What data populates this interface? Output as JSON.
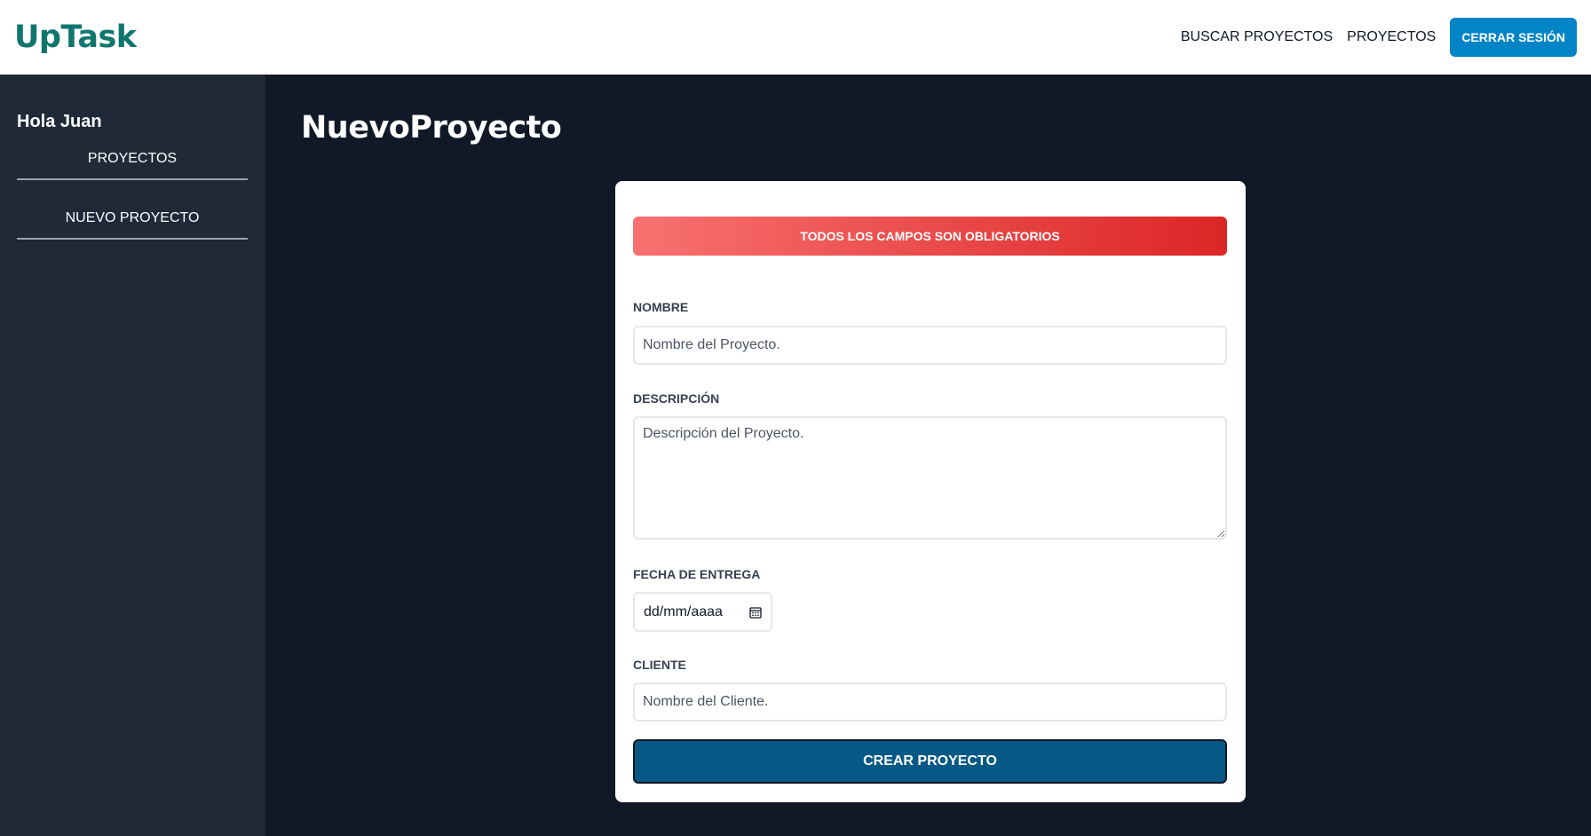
{
  "header": {
    "logo": "UpTask",
    "nav": {
      "search_label": "BUSCAR PROYECTOS",
      "projects_label": "PROYECTOS",
      "logout_label": "CERRAR SESIÓN"
    }
  },
  "sidebar": {
    "greeting": "Hola Juan",
    "items": [
      {
        "label": "PROYECTOS"
      },
      {
        "label": "NUEVO PROYECTO"
      }
    ]
  },
  "main": {
    "title": "NuevoProyecto",
    "form": {
      "alert": "TODOS LOS CAMPOS SON OBLIGATORIOS",
      "nombre": {
        "label": "NOMBRE",
        "placeholder": "Nombre del Proyecto.",
        "value": ""
      },
      "descripcion": {
        "label": "DESCRIPCIÓN",
        "placeholder": "Descripción del Proyecto.",
        "value": ""
      },
      "fecha": {
        "label": "FECHA DE ENTREGA",
        "placeholder": "dd/mm/aaaa",
        "icon": "calendar-icon"
      },
      "cliente": {
        "label": "CLIENTE",
        "placeholder": "Nombre del Cliente.",
        "value": ""
      },
      "submit_label": "CREAR PROYECTO"
    }
  },
  "colors": {
    "brand": "#0f766e",
    "header_bg": "#ffffff",
    "sidebar_bg": "#1f2937",
    "main_bg": "#111827",
    "logout_button": "#0284c7",
    "alert_from": "#f87171",
    "alert_to": "#dc2626",
    "submit_button": "#075985"
  }
}
